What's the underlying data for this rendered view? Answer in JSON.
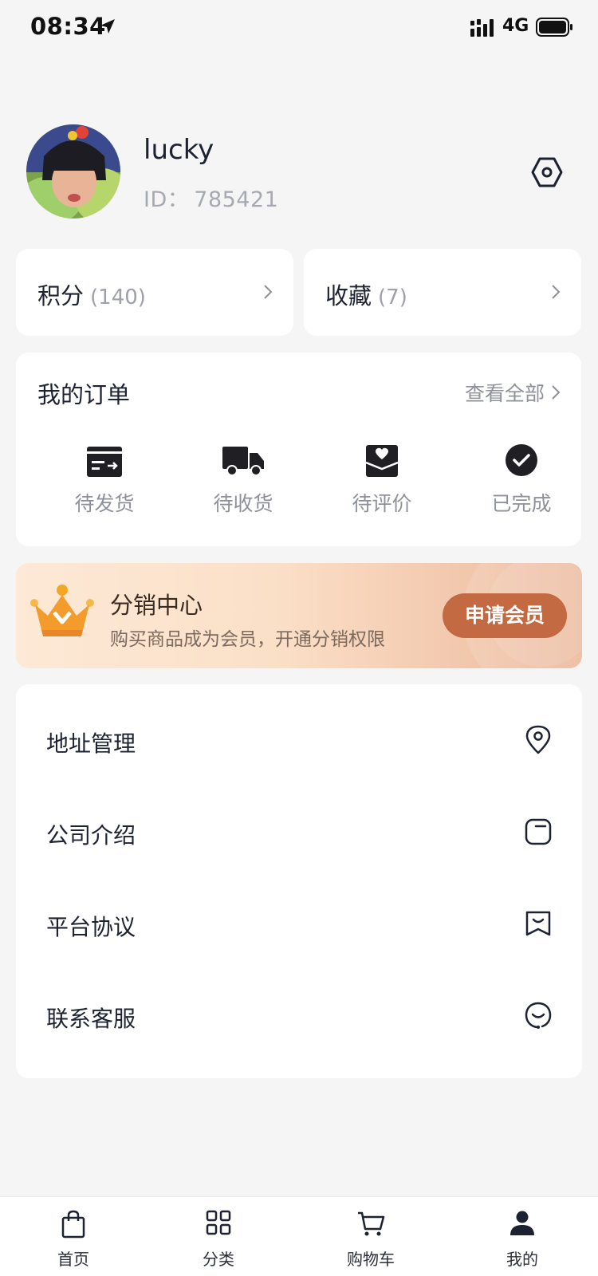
{
  "status_bar": {
    "time": "08:34",
    "network": "4G"
  },
  "profile": {
    "username": "lucky",
    "id_label": "ID：",
    "id_value": "785421"
  },
  "stats": [
    {
      "label": "积分",
      "count": "(140)"
    },
    {
      "label": "收藏",
      "count": "(7)"
    }
  ],
  "orders": {
    "title": "我的订单",
    "view_all": "查看全部",
    "items": [
      {
        "label": "待发货",
        "icon": "card-transfer-icon"
      },
      {
        "label": "待收货",
        "icon": "truck-icon"
      },
      {
        "label": "待评价",
        "icon": "heart-envelope-icon"
      },
      {
        "label": "已完成",
        "icon": "check-circle-icon"
      }
    ]
  },
  "distribution": {
    "title": "分销中心",
    "subtitle": "购买商品成为会员，开通分销权限",
    "button": "申请会员"
  },
  "menu": [
    {
      "label": "地址管理",
      "icon": "location-pin-icon"
    },
    {
      "label": "公司介绍",
      "icon": "document-icon"
    },
    {
      "label": "平台协议",
      "icon": "agreement-icon"
    },
    {
      "label": "联系客服",
      "icon": "customer-service-icon"
    }
  ],
  "tabs": [
    {
      "label": "首页",
      "icon": "shopping-bag-icon",
      "active": false
    },
    {
      "label": "分类",
      "icon": "grid-icon",
      "active": false
    },
    {
      "label": "购物车",
      "icon": "cart-icon",
      "active": false
    },
    {
      "label": "我的",
      "icon": "user-icon",
      "active": true
    }
  ],
  "colors": {
    "accent": "#c36a43",
    "background": "#f5f5f6",
    "text_primary": "#1d2233",
    "text_secondary": "#8e919a"
  }
}
